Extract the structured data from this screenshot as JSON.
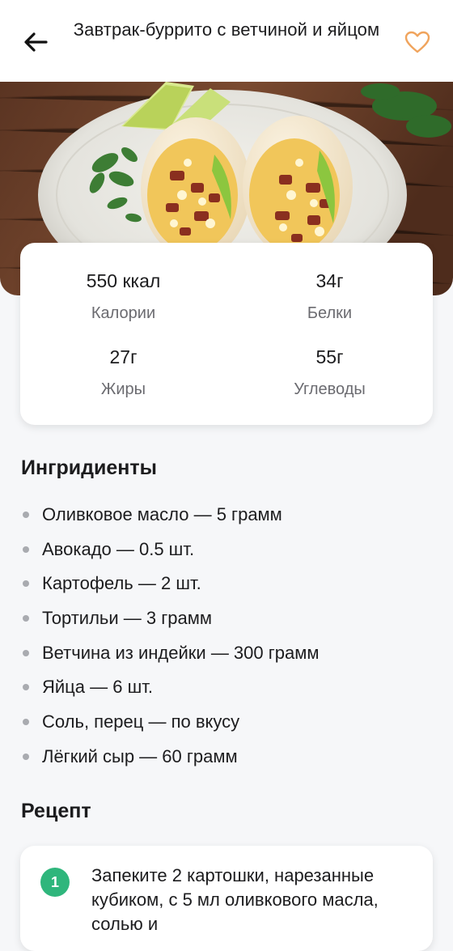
{
  "header": {
    "title": "Завтрак-буррито с ветчиной и яйцом",
    "back_icon": "arrow-left-icon",
    "favorite_icon": "heart-outline-icon",
    "accent_color": "#f0a45d"
  },
  "nutrition": [
    {
      "value": "550 ккал",
      "label": "Калории"
    },
    {
      "value": "34г",
      "label": "Белки"
    },
    {
      "value": "27г",
      "label": "Жиры"
    },
    {
      "value": "55г",
      "label": "Углеводы"
    }
  ],
  "ingredients": {
    "title": "Ингридиенты",
    "items": [
      "Оливковое масло — 5 грамм",
      "Авокадо — 0.5 шт.",
      "Картофель — 2 шт.",
      "Тортильи — 3 грамм",
      "Ветчина из индейки — 300 грамм",
      "Яйца — 6 шт.",
      "Соль, перец —  по вкусу",
      "Лёгкий сыр — 60 грамм"
    ]
  },
  "recipe": {
    "title": "Рецепт",
    "steps": [
      {
        "number": "1",
        "text": "Запеките 2 картошки, нарезанные кубиком, с 5 мл оливкового масла, солью и"
      }
    ],
    "step_color": "#2fb67c"
  }
}
